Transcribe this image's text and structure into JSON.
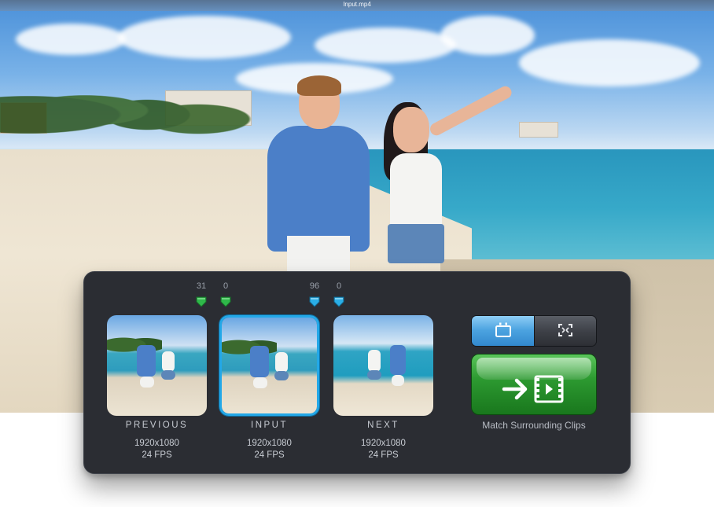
{
  "window": {
    "title": "Input.mp4"
  },
  "markers": {
    "previous_in": "31",
    "previous_out": "0",
    "input_in": "96",
    "input_out": "0"
  },
  "clips": [
    {
      "label": "PREVIOUS",
      "resolution": "1920x1080",
      "fps": "24 FPS",
      "selected": false
    },
    {
      "label": "INPUT",
      "resolution": "1920x1080",
      "fps": "24 FPS",
      "selected": true
    },
    {
      "label": "NEXT",
      "resolution": "1920x1080",
      "fps": "24 FPS",
      "selected": false
    }
  ],
  "view_toggle": {
    "active_icon": "single-frame-icon",
    "inactive_icon": "fit-frame-icon"
  },
  "match": {
    "label": "Match Surrounding Clips",
    "icon": "arrow-film-icon"
  },
  "colors": {
    "marker_green": "#2fb84a",
    "marker_blue": "#2aaee6",
    "selected_border": "#23a8e8",
    "match_button": "#2d9a31"
  }
}
